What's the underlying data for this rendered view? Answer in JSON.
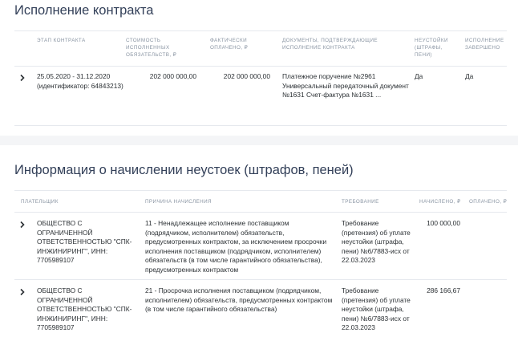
{
  "contract": {
    "title": "Исполнение контракта",
    "headers": {
      "stage": "ЭТАП КОНТРАКТА",
      "cost": "СТОИМОСТЬ ИСПОЛНЕННЫХ ОБЯЗАТЕЛЬСТВ, ₽",
      "paid": "ФАКТИЧЕСКИ ОПЛАЧЕНО, ₽",
      "docs": "ДОКУМЕНТЫ, ПОДТВЕРЖДАЮЩИЕ ИСПОЛНЕНИЕ КОНТРАКТА",
      "penalties": "НЕУСТОЙКИ (ШТРАФЫ, ПЕНИ)",
      "completed": "ИСПОЛНЕНИЕ ЗАВЕРШЕНО"
    },
    "rows": [
      {
        "stage": "25.05.2020 - 31.12.2020 (идентификатор: 64843213)",
        "cost": "202 000 000,00",
        "paid": "202 000 000,00",
        "docs": "Платежное поручение №2961 Универсальный передаточный документ №1631 Счет-фактура №1631 ...",
        "penalties": "Да",
        "completed": "Да"
      }
    ]
  },
  "penalties": {
    "title": "Информация о начислении неустоек (штрафов, пеней)",
    "headers": {
      "payer": "ПЛАТЕЛЬЩИК",
      "reason": "ПРИЧИНА НАЧИСЛЕНИЯ",
      "demand": "ТРЕБОВАНИЕ",
      "accrued": "НАЧИСЛЕНО, ₽",
      "paid": "ОПЛАЧЕНО, ₽"
    },
    "rows": [
      {
        "payer": "ОБЩЕСТВО С ОГРАНИЧЕННОЙ ОТВЕТСТВЕННОСТЬЮ \"СПК-ИНЖИНИРИНГ\", ИНН: 7705989107",
        "reason": "11 - Ненадлежащее исполнение поставщиком (подрядчиком, исполнителем) обязательств, предусмотренных контрактом, за исключением просрочки исполнения поставщиком (подрядчиком, исполнителем) обязательств (в том числе гарантийного обязательства), предусмотренных контрактом",
        "demand": "Требование (претензия) об уплате неустойки (штрафа, пени) №6/7883-исх от 22.03.2023",
        "accrued": "100 000,00",
        "paid": ""
      },
      {
        "payer": "ОБЩЕСТВО С ОГРАНИЧЕННОЙ ОТВЕТСТВЕННОСТЬЮ \"СПК-ИНЖИНИРИНГ\", ИНН: 7705989107",
        "reason": "21 - Просрочка исполнения поставщиком (подрядчиком, исполнителем) обязательств, предусмотренных контрактом (в том числе гарантийного обязательства)",
        "demand": "Требование (претензия) об уплате неустойки (штрафа, пени) №6/7883-исх от 22.03.2023",
        "accrued": "286 166,67",
        "paid": ""
      }
    ]
  }
}
